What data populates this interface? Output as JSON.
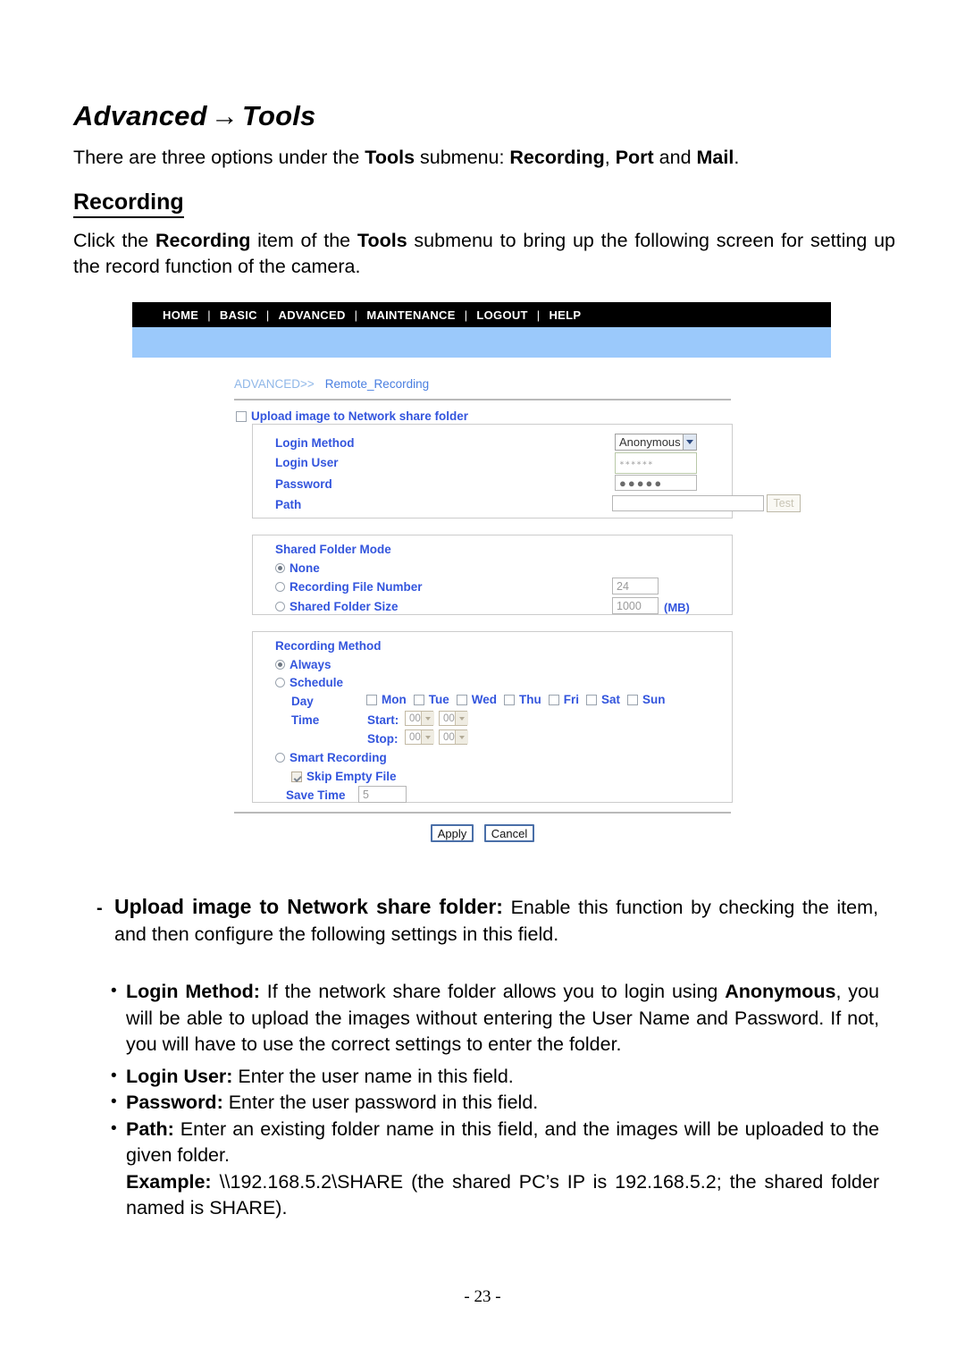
{
  "document": {
    "title_main": "Advanced",
    "title_arrow": "→",
    "title_sub": "Tools",
    "intro_parts": {
      "a": "There are three options under the ",
      "b1": "Tools",
      "c": " submenu: ",
      "b2": "Recording",
      "d": ", ",
      "b3": "Port",
      "e": " and ",
      "b4": "Mail",
      "f": "."
    },
    "subheading": "Recording",
    "para2_parts": {
      "a": "Click the ",
      "b1": "Recording",
      "c": " item of the ",
      "b2": "Tools",
      "d": " submenu to bring up the following screen for setting up the record function of the camera."
    },
    "page_number": "- 23 -"
  },
  "notes": {
    "dash_marker": "-",
    "dash_lead": "Upload image to Network share folder:",
    "dash_body": " Enable this function by checking the item, and then configure the following settings in this field.",
    "bullet_marker": "•",
    "items": [
      {
        "lead": "Login Method:",
        "body_a": " If the network share folder allows you to login using ",
        "bold_mid": "Anonymous",
        "body_b": ", you will be able to upload the images without entering the User Name and Password.  If not, you will have to use the correct settings to enter the folder."
      },
      {
        "lead": "Login User:",
        "body_a": " Enter the user name in this field.",
        "bold_mid": "",
        "body_b": ""
      },
      {
        "lead": "Password:",
        "body_a": " Enter the user password in this field.",
        "bold_mid": "",
        "body_b": ""
      },
      {
        "lead": "Path:",
        "body_a": " Enter an existing folder name in this field, and the images will be uploaded to the given folder.",
        "bold_mid": "",
        "body_b": "",
        "example_lead": "Example:",
        "example_body": " \\\\192.168.5.2\\SHARE (the shared PC’s IP is 192.168.5.2; the shared folder named is SHARE)."
      }
    ]
  },
  "screenshot": {
    "nav": {
      "separator": "|",
      "items": [
        "HOME",
        "BASIC",
        "ADVANCED",
        "MAINTENANCE",
        "LOGOUT",
        "HELP"
      ]
    },
    "breadcrumb": {
      "parent": "ADVANCED>>",
      "current": "Remote_Recording"
    },
    "upload_checkbox": {
      "label": "Upload image to Network share folder",
      "checked": false
    },
    "network_panel": {
      "login_method_label": "Login Method",
      "login_method_value": "Anonymous",
      "login_user_label": "Login User",
      "login_user_value": "∗∗∗∗∗∗",
      "password_label": "Password",
      "password_value": "●●●●●",
      "path_label": "Path",
      "path_value": "",
      "test_button": "Test"
    },
    "shared_folder_panel": {
      "title": "Shared Folder  Mode",
      "options": [
        {
          "label": "None",
          "selected": true,
          "value": ""
        },
        {
          "label": "Recording File Number",
          "selected": false,
          "value": "24"
        },
        {
          "label": "Shared Folder Size",
          "selected": false,
          "value": "1000"
        }
      ],
      "size_unit": "(MB)"
    },
    "recording_panel": {
      "title": "Recording Method",
      "always_label": "Always",
      "always_selected": true,
      "schedule_label": "Schedule",
      "schedule_selected": false,
      "day_label": "Day",
      "days": [
        "Mon",
        "Tue",
        "Wed",
        "Thu",
        "Fri",
        "Sat",
        "Sun"
      ],
      "time_label": "Time",
      "start_label": "Start:",
      "start_hour": "00",
      "start_minute": "00",
      "stop_label": "Stop:",
      "stop_hour": "00",
      "stop_minute": "00",
      "smart_label": "Smart Recording",
      "smart_selected": false,
      "skip_empty_label": "Skip Empty File",
      "skip_empty_checked": true,
      "save_time_label": "Save  Time",
      "save_time_value": "5"
    },
    "actions": {
      "apply": "Apply",
      "cancel": "Cancel"
    },
    "colors": {
      "nav_bg": "#000000",
      "strip": "#9bc9fb",
      "label_blue": "#3355dd",
      "crumb_parent": "#8fb7e8",
      "crumb_current": "#4a7fe0"
    }
  }
}
